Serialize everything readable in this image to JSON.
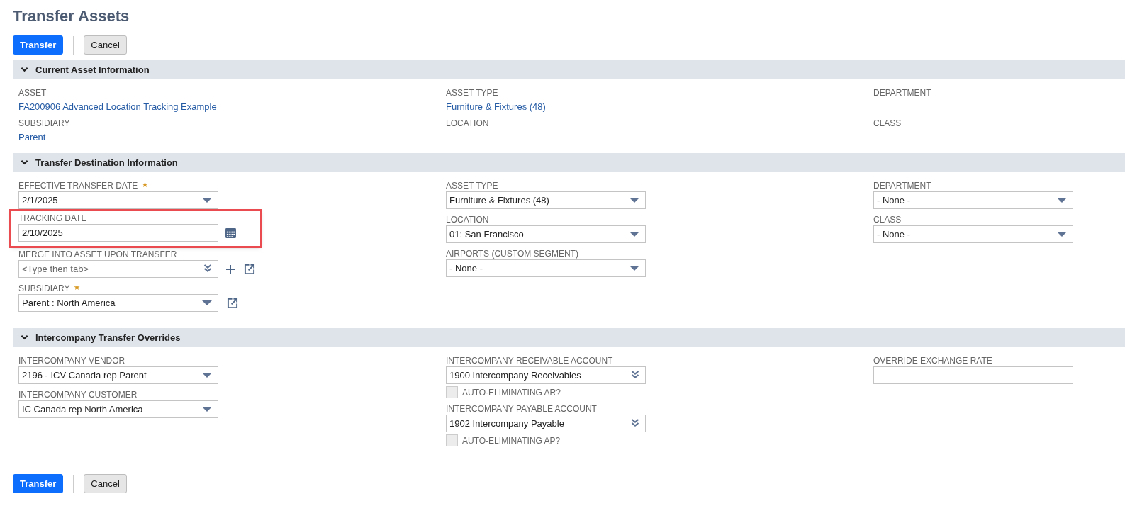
{
  "title": "Transfer Assets",
  "buttons": [
    {
      "label": "Transfer",
      "kind": "primary"
    },
    {
      "label": "Cancel",
      "kind": "secondary"
    }
  ],
  "sections": [
    {
      "title": "Current Asset Information",
      "expanded": true,
      "columns": [
        [
          {
            "kind": "display",
            "label": "ASSET",
            "value": "FA200906 Advanced Location Tracking Example"
          },
          {
            "kind": "display",
            "label": "SUBSIDIARY",
            "value": "Parent"
          }
        ],
        [
          {
            "kind": "display",
            "label": "ASSET TYPE",
            "value": "Furniture & Fixtures (48)"
          },
          {
            "kind": "display",
            "label": "LOCATION"
          }
        ],
        [
          {
            "kind": "display",
            "label": "DEPARTMENT"
          },
          {
            "kind": "display",
            "label": "CLASS"
          }
        ]
      ]
    },
    {
      "title": "Transfer Destination Information",
      "expanded": true,
      "columns": [
        [
          {
            "kind": "select",
            "label": "EFFECTIVE TRANSFER DATE",
            "required": true,
            "value": "2/1/2025"
          },
          {
            "kind": "date",
            "label": "TRACKING DATE",
            "value": "2/10/2025",
            "highlighted": true
          },
          {
            "kind": "combo",
            "label": "MERGE INTO ASSET UPON TRANSFER",
            "placeholder": "<Type then tab>",
            "add_button": true,
            "open_button": true
          },
          {
            "kind": "select",
            "label": "SUBSIDIARY",
            "required": true,
            "value": "Parent : North America",
            "open_button": true
          }
        ],
        [
          {
            "kind": "select",
            "label": "ASSET TYPE",
            "value": "Furniture & Fixtures (48)"
          },
          {
            "kind": "select",
            "label": "LOCATION",
            "value": "01: San Francisco"
          },
          {
            "kind": "select",
            "label": "AIRPORTS (CUSTOM SEGMENT)",
            "value": "- None -"
          }
        ],
        [
          {
            "kind": "select",
            "label": "DEPARTMENT",
            "value": "- None -"
          },
          {
            "kind": "select",
            "label": "CLASS",
            "value": "- None -"
          }
        ]
      ]
    },
    {
      "title": "Intercompany Transfer Overrides",
      "expanded": true,
      "columns": [
        [
          {
            "kind": "select",
            "label": "INTERCOMPANY VENDOR",
            "value": "2196 - ICV Canada rep Parent"
          },
          {
            "kind": "select",
            "label": "INTERCOMPANY CUSTOMER",
            "value": "IC Canada rep North America"
          }
        ],
        [
          {
            "kind": "combo",
            "label": "INTERCOMPANY RECEIVABLE ACCOUNT",
            "value": "1900 Intercompany Receivables"
          },
          {
            "kind": "checkbox",
            "label": "AUTO-ELIMINATING AR?",
            "checked": false,
            "disabled": true
          },
          {
            "kind": "combo",
            "label": "INTERCOMPANY PAYABLE ACCOUNT",
            "value": "1902 Intercompany Payable"
          },
          {
            "kind": "checkbox",
            "label": "AUTO-ELIMINATING AP?",
            "checked": false,
            "disabled": true
          }
        ],
        [
          {
            "kind": "text",
            "label": "OVERRIDE EXCHANGE RATE"
          }
        ]
      ]
    }
  ],
  "footer_buttons": [
    {
      "label": "Transfer",
      "kind": "primary"
    },
    {
      "label": "Cancel",
      "kind": "secondary"
    }
  ]
}
